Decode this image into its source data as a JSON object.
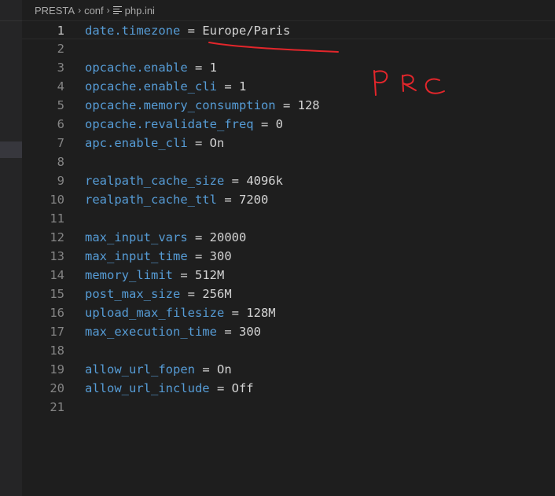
{
  "breadcrumb": {
    "items": [
      "PRESTA",
      "conf",
      "php.ini"
    ],
    "separator_icon": "chevron-right-icon",
    "file_icon": "ini-file-icon"
  },
  "editor": {
    "lines": [
      {
        "n": "1",
        "key": "date.timezone",
        "eq": " = ",
        "value": "Europe/Paris"
      },
      {
        "n": "2",
        "key": "",
        "eq": "",
        "value": ""
      },
      {
        "n": "3",
        "key": "opcache.enable",
        "eq": " = ",
        "value": "1"
      },
      {
        "n": "4",
        "key": "opcache.enable_cli",
        "eq": " = ",
        "value": "1"
      },
      {
        "n": "5",
        "key": "opcache.memory_consumption",
        "eq": " = ",
        "value": "128"
      },
      {
        "n": "6",
        "key": "opcache.revalidate_freq",
        "eq": " = ",
        "value": "0"
      },
      {
        "n": "7",
        "key": "apc.enable_cli",
        "eq": " = ",
        "value": "On"
      },
      {
        "n": "8",
        "key": "",
        "eq": "",
        "value": ""
      },
      {
        "n": "9",
        "key": "realpath_cache_size",
        "eq": " = ",
        "value": "4096k"
      },
      {
        "n": "10",
        "key": "realpath_cache_ttl",
        "eq": " = ",
        "value": "7200"
      },
      {
        "n": "11",
        "key": "",
        "eq": "",
        "value": ""
      },
      {
        "n": "12",
        "key": "max_input_vars",
        "eq": " = ",
        "value": "20000"
      },
      {
        "n": "13",
        "key": "max_input_time",
        "eq": " = ",
        "value": "300"
      },
      {
        "n": "14",
        "key": "memory_limit",
        "eq": " = ",
        "value": "512M"
      },
      {
        "n": "15",
        "key": "post_max_size",
        "eq": " = ",
        "value": "256M"
      },
      {
        "n": "16",
        "key": "upload_max_filesize",
        "eq": " = ",
        "value": "128M"
      },
      {
        "n": "17",
        "key": "max_execution_time",
        "eq": " = ",
        "value": "300"
      },
      {
        "n": "18",
        "key": "",
        "eq": "",
        "value": ""
      },
      {
        "n": "19",
        "key": "allow_url_fopen",
        "eq": " = ",
        "value": "On"
      },
      {
        "n": "20",
        "key": "allow_url_include",
        "eq": " = ",
        "value": "Off"
      },
      {
        "n": "21",
        "key": "",
        "eq": "",
        "value": ""
      }
    ]
  },
  "annotation": {
    "handwritten_text": "PRC",
    "color": "#e3262b"
  },
  "colors": {
    "background": "#1e1e1e",
    "key": "#569cd6",
    "value": "#d4d4d4",
    "line_number": "#858585"
  }
}
